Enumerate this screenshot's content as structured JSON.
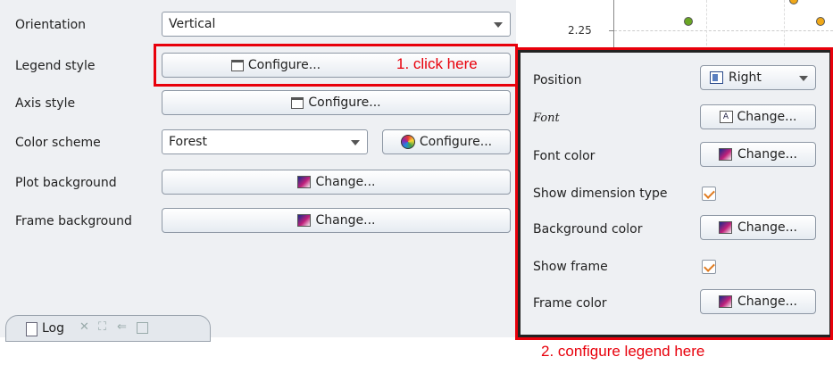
{
  "settings": {
    "orientation_label": "Orientation",
    "orientation_value": "Vertical",
    "legend_style_label": "Legend style",
    "legend_configure": "Configure...",
    "axis_style_label": "Axis style",
    "axis_configure": "Configure...",
    "color_scheme_label": "Color scheme",
    "color_scheme_value": "Forest",
    "color_configure": "Configure...",
    "plot_background_label": "Plot background",
    "plot_change": "Change...",
    "frame_background_label": "Frame background",
    "frame_change": "Change..."
  },
  "annotations": {
    "step1": "1. click here",
    "step2": "2. configure legend here"
  },
  "log_tab": {
    "label": "Log"
  },
  "chart": {
    "tick_label": "2.25",
    "point_colors": [
      "#6aa624",
      "#f0a818"
    ]
  },
  "legend_popup": {
    "position_label": "Position",
    "position_value": "Right",
    "font_label": "Font",
    "font_button": "Change...",
    "font_color_label": "Font color",
    "font_color_button": "Change...",
    "show_dimension_type_label": "Show dimension type",
    "show_dimension_type_checked": true,
    "background_color_label": "Background color",
    "background_color_button": "Change...",
    "show_frame_label": "Show frame",
    "show_frame_checked": true,
    "frame_color_label": "Frame color",
    "frame_color_button": "Change..."
  }
}
